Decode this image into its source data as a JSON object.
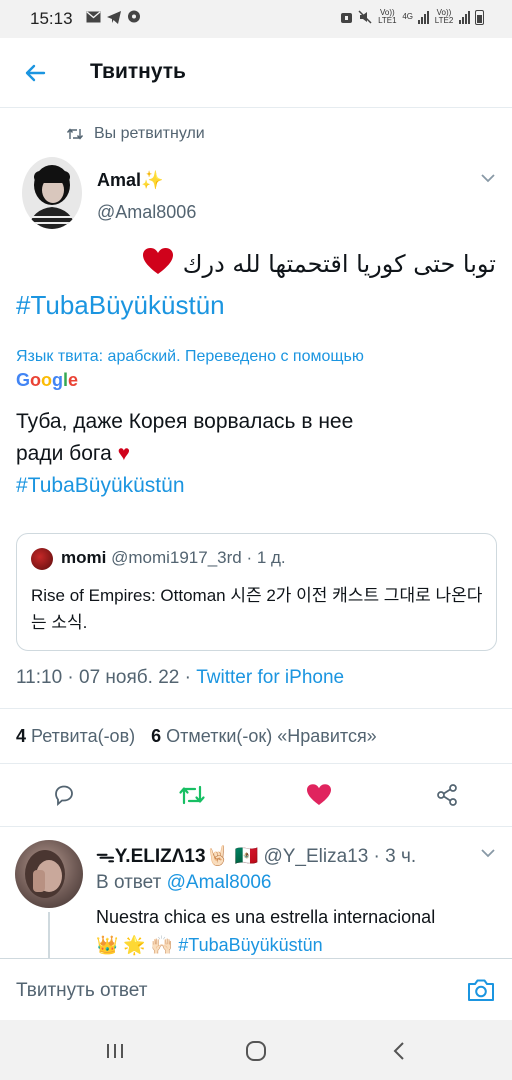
{
  "status_bar": {
    "time": "15:13",
    "volte1": "Vo)) LTE1",
    "net": "4G",
    "volte2": "Vo)) LTE2"
  },
  "header": {
    "title": "Твитнуть"
  },
  "retweet_context": "Вы ретвитнули",
  "tweet": {
    "author_name": "Amal✨",
    "author_handle": "@Amal8006",
    "text_arabic": "توبا حتى كوريا اقتحمتها لله درك",
    "heart_emoji": "♥",
    "hashtag": "#TubaBüyüküstün",
    "translation_note": "Язык твита: арабский. Переведено с помощью",
    "translation_provider": "Google",
    "translation_line1": "Туба, даже Корея ворвалась в нее",
    "translation_line2": "ради бога",
    "translation_hashtag": "#TubaBüyüküstün",
    "timestamp": "11:10 · 07 нояб. 22 · ",
    "source": "Twitter for iPhone"
  },
  "quote": {
    "name": "momi",
    "meta": "@momi1917_3rd · 1 д.",
    "text": "Rise of Empires: Ottoman 시즌 2가 이전 캐스트 그대로 나온다는 소식."
  },
  "stats": {
    "retweets_count": "4",
    "retweets_label": "Ретвита(-ов)",
    "likes_count": "6",
    "likes_label": "Отметки(-ок) «Нравится»"
  },
  "reply": {
    "name": "ᯓY.ELIZΛ13🤘🏻 🇲🇽",
    "meta": "@Y_Eliza13 · 3 ч.",
    "reply_to_prefix": "В ответ ",
    "reply_to_handle": "@Amal8006",
    "text_line1": "Nuestra chica es una estrella internacional",
    "text_emojis": "👑 🌟 🙌🏻 ",
    "text_hashtag": "#TubaBüyüküstün"
  },
  "composer": {
    "placeholder": "Твитнуть ответ"
  },
  "colors": {
    "accent": "#1b95e0",
    "like": "#e0245e",
    "retweet": "#17bf63"
  },
  "icons": [
    "back-arrow-icon",
    "retweet-icon",
    "chevron-down-icon",
    "reply-icon",
    "like-icon",
    "share-icon",
    "camera-icon",
    "recents-icon",
    "home-icon",
    "back-nav-icon"
  ]
}
